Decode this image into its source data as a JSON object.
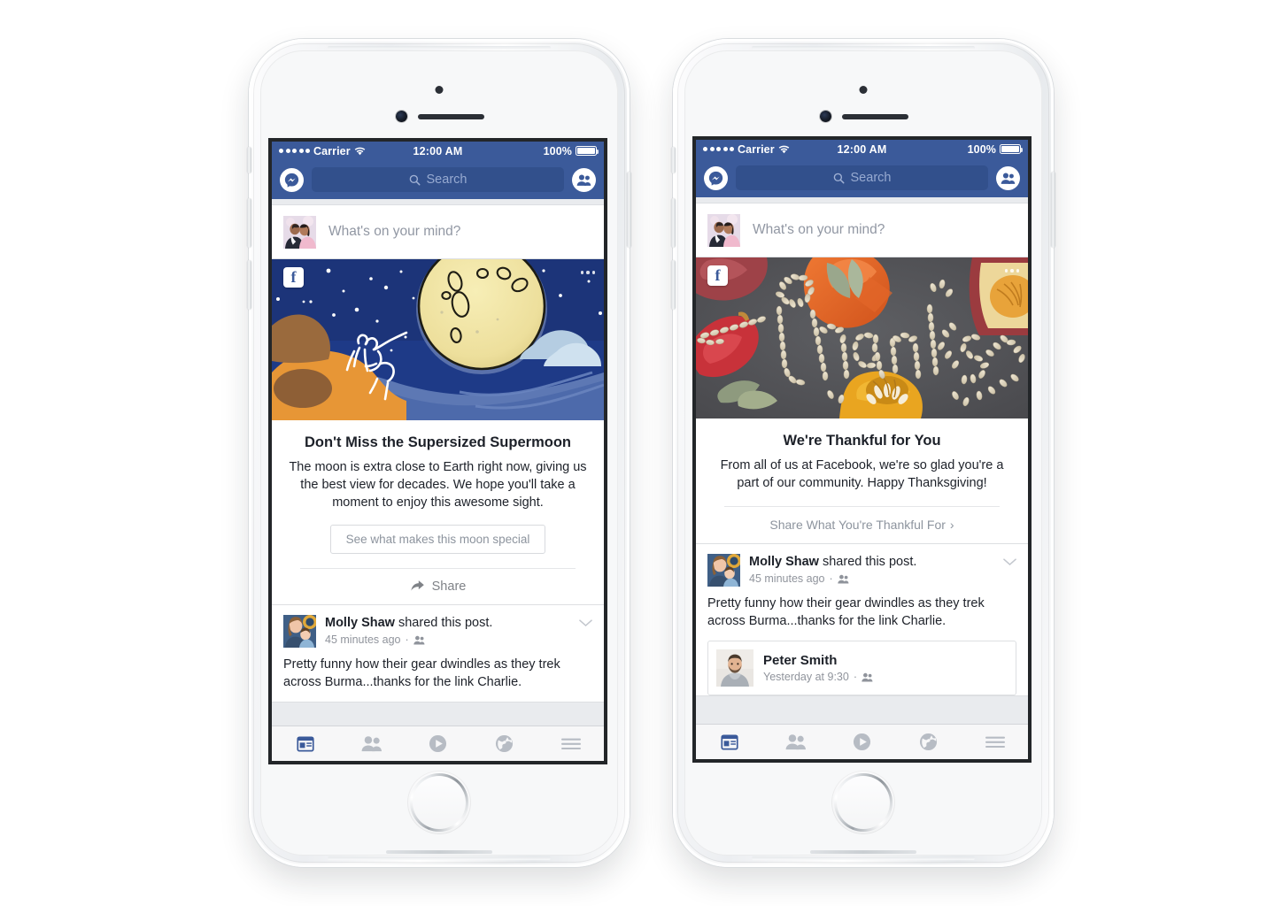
{
  "status_bar": {
    "carrier": "Carrier",
    "signal_dots": 5,
    "wifi_icon": "wifi-icon",
    "time": "12:00 AM",
    "battery_percent": "100%",
    "battery_icon": "battery-full-icon"
  },
  "top_bar": {
    "messenger_icon": "messenger-icon",
    "friends_icon": "friend-requests-icon",
    "search_icon": "search-icon",
    "search_placeholder": "Search"
  },
  "composer": {
    "avatar_name": "user-avatar",
    "placeholder": "What's on your mind?"
  },
  "phones": [
    {
      "id": "left",
      "sponsored_card": {
        "image_alt": "supermoon-illustration",
        "badge_icon": "facebook-logo-badge",
        "more_icon": "ellipsis-icon",
        "title": "Don't Miss the Supersized Supermoon",
        "description": "The moon is extra close to Earth right now, giving us the best view for decades. We hope you'll take a moment to enjoy this awesome sight.",
        "cta_label": "See what makes this moon special",
        "share_label": "Share",
        "share_icon": "share-arrow-icon"
      },
      "post": {
        "avatar_name": "molly-shaw-avatar",
        "author": "Molly Shaw",
        "action": " shared this post.",
        "timestamp": "45 minutes ago",
        "audience_icon": "friends-audience-icon",
        "chevron_icon": "chevron-down-icon",
        "body": "Pretty funny how their gear dwindles as they trek across Burma...thanks for the link Charlie."
      }
    },
    {
      "id": "right",
      "sponsored_card": {
        "image_alt": "thanks-pumpkin-seeds-photo",
        "badge_icon": "facebook-logo-badge",
        "more_icon": "ellipsis-icon",
        "title": "We're Thankful for You",
        "description": "From all of us at Facebook, we're so glad you're a part of our community. Happy Thanksgiving!",
        "link_label": "Share What You're Thankful For",
        "link_chevron": "›"
      },
      "post": {
        "avatar_name": "molly-shaw-avatar",
        "author": "Molly Shaw",
        "action": " shared this post.",
        "timestamp": "45 minutes ago",
        "audience_icon": "friends-audience-icon",
        "chevron_icon": "chevron-down-icon",
        "body": "Pretty funny how their gear dwindles as they trek across Burma...thanks for the link Charlie.",
        "attached": {
          "avatar_name": "peter-smith-avatar",
          "name": "Peter Smith",
          "timestamp": "Yesterday at 9:30",
          "audience_icon": "friends-audience-icon"
        }
      }
    }
  ],
  "tab_bar": {
    "tabs": [
      {
        "name": "news-feed",
        "icon": "news-feed-icon",
        "active": true
      },
      {
        "name": "friends",
        "icon": "friends-icon",
        "active": false
      },
      {
        "name": "video",
        "icon": "play-circle-icon",
        "active": false
      },
      {
        "name": "notifications",
        "icon": "globe-icon",
        "active": false
      },
      {
        "name": "more",
        "icon": "hamburger-menu-icon",
        "active": false
      }
    ]
  },
  "colors": {
    "facebook_blue": "#3b5a9a",
    "search_field": "#32508c",
    "feed_bg": "#e9ebee",
    "card_border": "#dddfe2",
    "text_primary": "#1d2129",
    "text_muted": "#90949c",
    "active_tab": "#3b5a9a"
  },
  "hardware": {
    "sensor_icon": "proximity-sensor",
    "camera_icon": "front-camera",
    "speaker_icon": "earpiece-speaker",
    "home_button_icon": "home-button"
  }
}
